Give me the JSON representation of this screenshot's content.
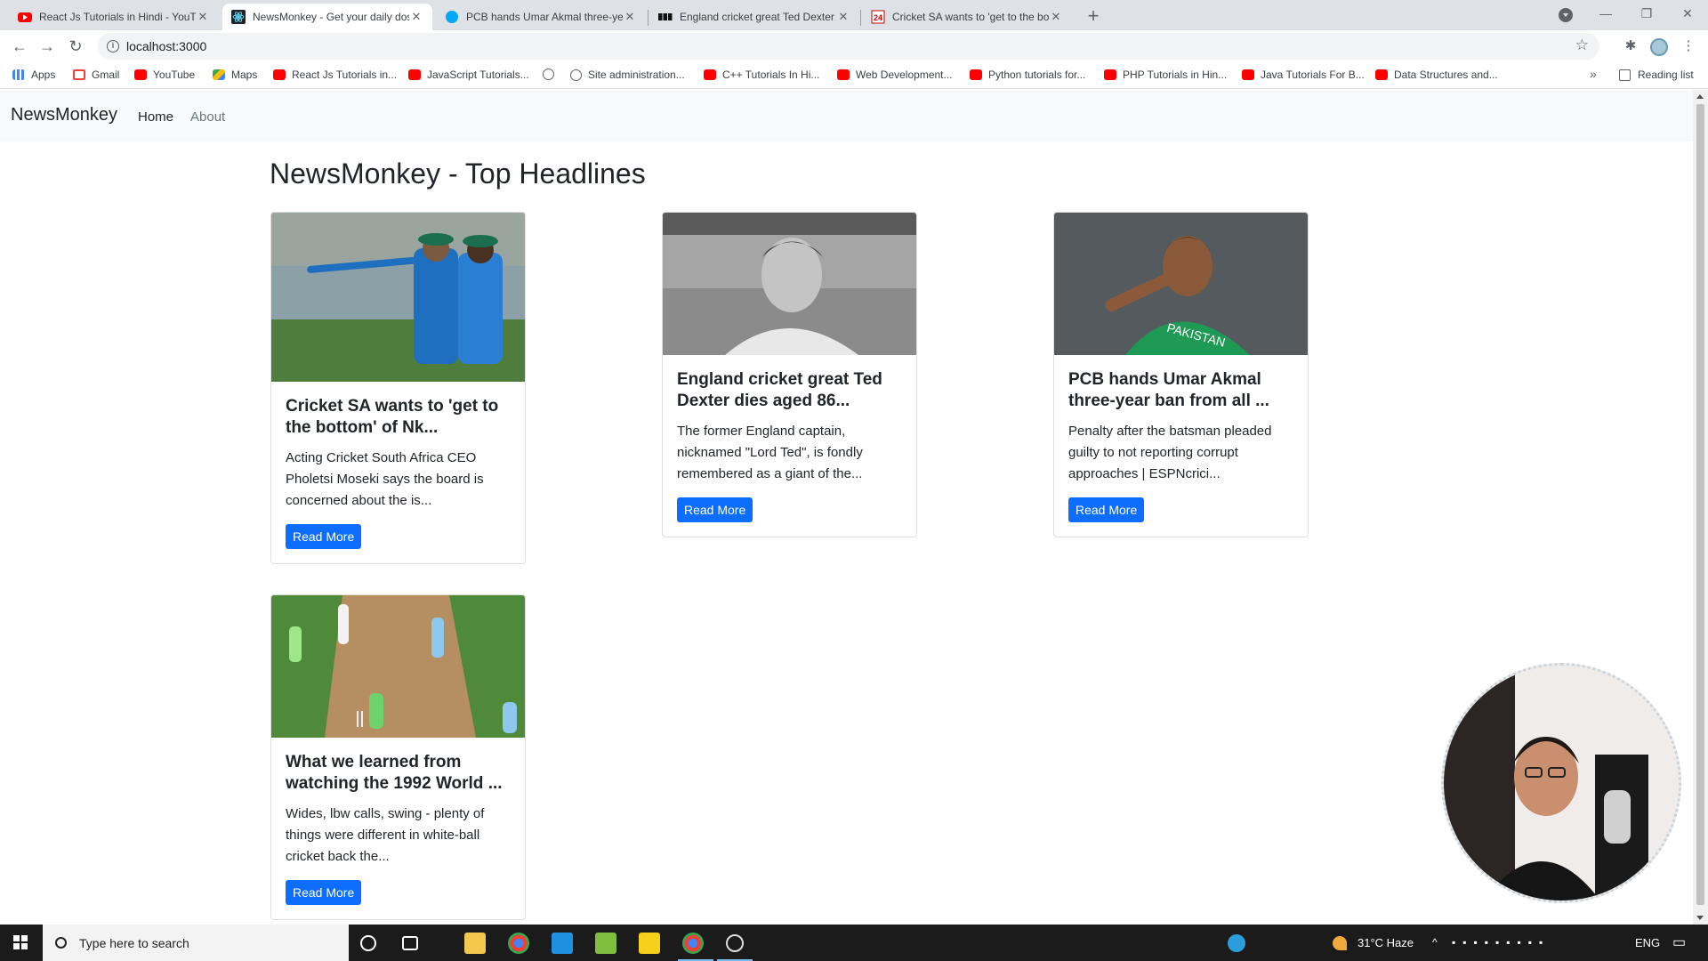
{
  "browser": {
    "tabs": [
      {
        "title": "React Js Tutorials in Hindi - YouTube",
        "icon": "youtube-icon",
        "active": false
      },
      {
        "title": "NewsMonkey - Get your daily dose of news free",
        "icon": "react-icon",
        "active": true
      },
      {
        "title": "PCB hands Umar Akmal three-year ban",
        "icon": "cricinfo-icon",
        "active": false
      },
      {
        "title": "England cricket great Ted Dexter dies",
        "icon": "bbc-icon",
        "active": false
      },
      {
        "title": "Cricket SA wants to 'get to the bottom'",
        "icon": "news24-icon",
        "active": false
      }
    ],
    "url": "localhost:3000",
    "bookmarks": [
      {
        "label": "Apps",
        "icon": "apps-icon"
      },
      {
        "label": "Gmail",
        "icon": "gmail-icon"
      },
      {
        "label": "YouTube",
        "icon": "youtube-icon"
      },
      {
        "label": "Maps",
        "icon": "maps-icon"
      },
      {
        "label": "React Js Tutorials in...",
        "icon": "youtube-icon"
      },
      {
        "label": "JavaScript Tutorials...",
        "icon": "youtube-icon"
      },
      {
        "label": "",
        "icon": "globe-icon"
      },
      {
        "label": "Site administration...",
        "icon": "globe-icon"
      },
      {
        "label": "C++ Tutorials In Hi...",
        "icon": "youtube-icon"
      },
      {
        "label": "Web Development...",
        "icon": "youtube-icon"
      },
      {
        "label": "Python tutorials for...",
        "icon": "youtube-icon"
      },
      {
        "label": "PHP Tutorials in Hin...",
        "icon": "youtube-icon"
      },
      {
        "label": "Java Tutorials For B...",
        "icon": "youtube-icon"
      },
      {
        "label": "Data Structures and...",
        "icon": "youtube-icon"
      }
    ],
    "more": "»",
    "reading_list": "Reading list"
  },
  "navbar": {
    "brand": "NewsMonkey",
    "links": [
      "Home",
      "About"
    ]
  },
  "page": {
    "heading": "NewsMonkey - Top Headlines",
    "read_more": "Read More",
    "articles": [
      {
        "title": "Cricket SA wants to 'get to the bottom' of Nk...",
        "description": "Acting Cricket South Africa CEO Pholetsi Moseki says the board is concerned about the is...",
        "image": "cricket-coaches-photo"
      },
      {
        "title": "England cricket great Ted Dexter dies aged 86...",
        "description": "The former England captain, nicknamed \"Lord Ted\", is fondly remembered as a giant of the...",
        "image": "ted-dexter-portrait-photo"
      },
      {
        "title": "PCB hands Umar Akmal three-year ban from all ...",
        "description": "Penalty after the batsman pleaded guilty to not reporting corrupt approaches | ESPNcrici...",
        "image": "umar-akmal-photo"
      },
      {
        "title": "What we learned from watching the 1992 World ...",
        "description": "Wides, lbw calls, swing - plenty of things were different in white-ball cricket back the...",
        "image": "1992-world-cup-match-photo"
      }
    ]
  },
  "taskbar": {
    "search_placeholder": "Type here to search",
    "weather": "31°C  Haze",
    "language": "ENG"
  },
  "colors": {
    "primary_button": "#0d6efd",
    "navbar_bg": "#f8f9fa",
    "tabstrip_bg": "#dee1e6",
    "taskbar_bg": "#1b1b1b"
  }
}
